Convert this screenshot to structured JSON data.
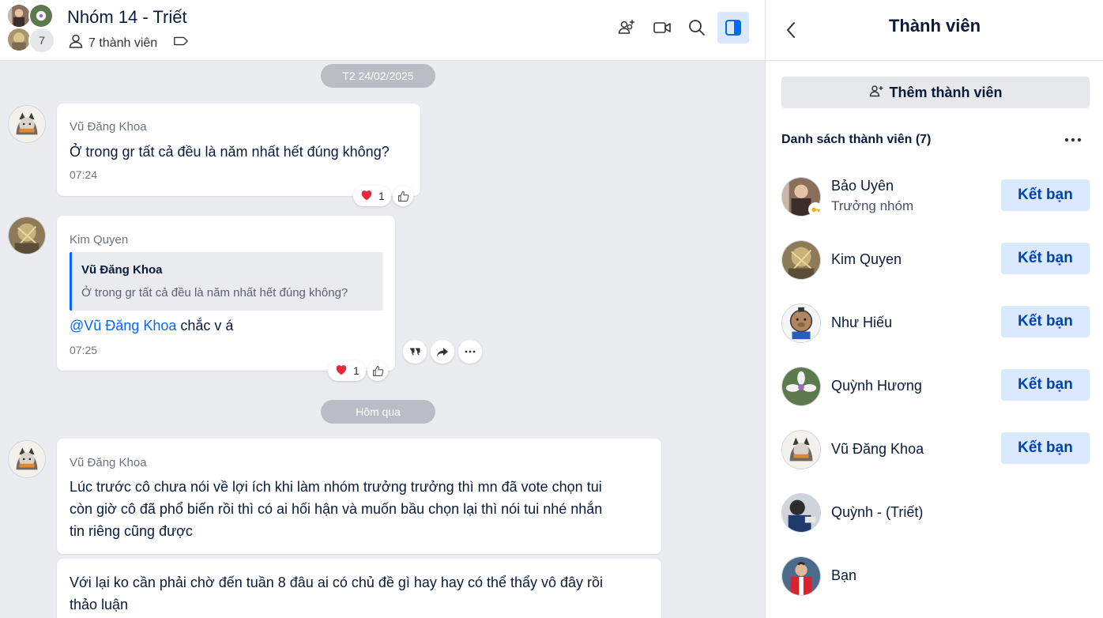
{
  "chat": {
    "group_name": "Nhóm 14 - Triết",
    "avatar_overflow_count": "7",
    "member_count_label": "7 thành viên",
    "header_actions": [
      "add-member-icon",
      "video-call-icon",
      "search-icon",
      "toggle-panel-icon"
    ],
    "date_dividers": [
      "T2 24/02/2025",
      "Hôm qua"
    ],
    "messages": [
      {
        "sender": "Vũ Đăng Khoa",
        "text": "Ở trong gr tất cả đều là năm nhất hết đúng không?",
        "time": "07:24",
        "reaction_count": "1"
      },
      {
        "sender": "Kim Quyen",
        "quote": {
          "name": "Vũ Đăng Khoa",
          "text": "Ở trong gr tất cả đều là năm nhất hết đúng không?"
        },
        "mention": "@Vũ Đăng Khoa",
        "text": " chắc v á",
        "time": "07:25",
        "reaction_count": "1"
      },
      {
        "sender": "Vũ Đăng Khoa",
        "lines": [
          "Lúc trước cô chưa nói về lợi ích khi làm nhóm trưởng trưởng thì mn đã vote chọn tui",
          "còn giờ cô đã phổ biến rồi thì có ai hối hận và muốn bầu chọn lại thì nói tui nhé nhắn",
          "tin riêng cũng được"
        ]
      },
      {
        "lines": [
          "Với lại ko cần phải chờ đến tuần 8 đâu ai có chủ đề gì hay hay có thể thẩy vô đây rồi",
          "thảo luận"
        ]
      }
    ]
  },
  "panel": {
    "title": "Thành viên",
    "add_member_label": "Thêm thành viên",
    "list_title": "Danh sách thành viên (7)",
    "members": [
      {
        "name": "Bảo Uyên",
        "role": "Trưởng nhóm",
        "action": "Kết bạn"
      },
      {
        "name": "Kim Quyen",
        "action": "Kết bạn"
      },
      {
        "name": "Như Hiếu",
        "action": "Kết bạn"
      },
      {
        "name": "Quỳnh Hương",
        "action": "Kết bạn"
      },
      {
        "name": "Vũ Đăng Khoa",
        "action": "Kết bạn"
      },
      {
        "name": "Quỳnh - (Triết)"
      },
      {
        "name": "Bạn"
      }
    ]
  },
  "colors": {
    "accent": "#0068ff",
    "friend_button_bg": "#dbe9fe",
    "chat_bg": "#ebecf0",
    "reaction_heart": "#e5283c"
  }
}
